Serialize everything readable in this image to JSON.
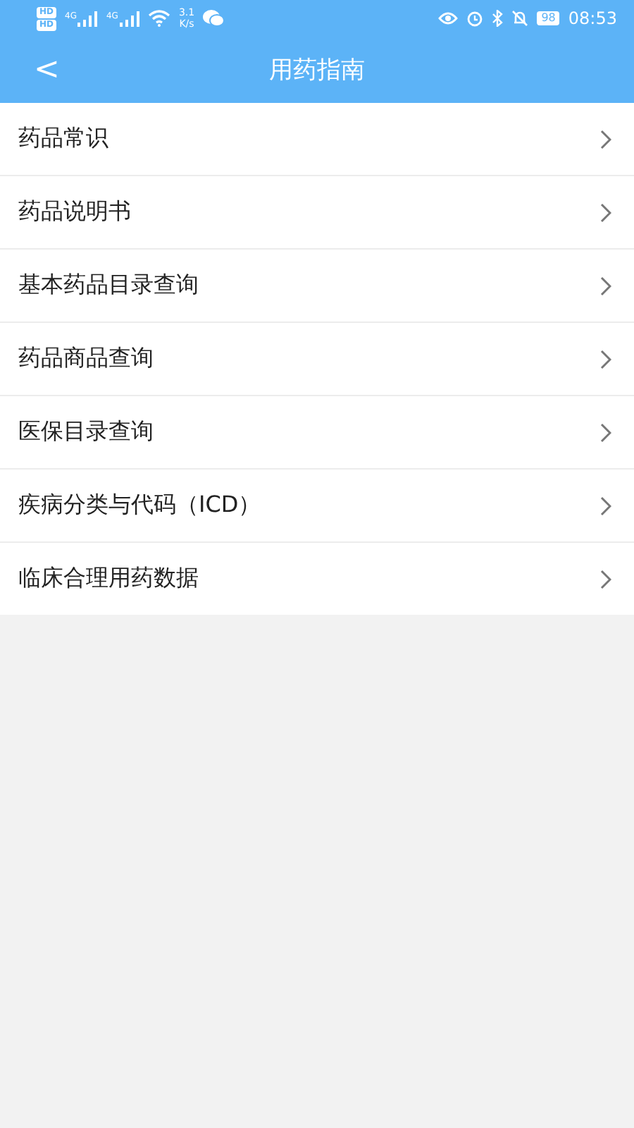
{
  "status_bar": {
    "hd_badges": [
      "HD",
      "HD"
    ],
    "network_types": [
      "4G",
      "4G"
    ],
    "speed_value": "3.1",
    "speed_unit": "K/s",
    "battery": "98",
    "time": "08:53"
  },
  "header": {
    "back": "<",
    "title": "用药指南"
  },
  "menu_items": [
    {
      "label": "药品常识"
    },
    {
      "label": "药品说明书"
    },
    {
      "label": "基本药品目录查询"
    },
    {
      "label": "药品商品查询"
    },
    {
      "label": "医保目录查询"
    },
    {
      "label": "疾病分类与代码（ICD）"
    },
    {
      "label": "临床合理用药数据"
    }
  ]
}
